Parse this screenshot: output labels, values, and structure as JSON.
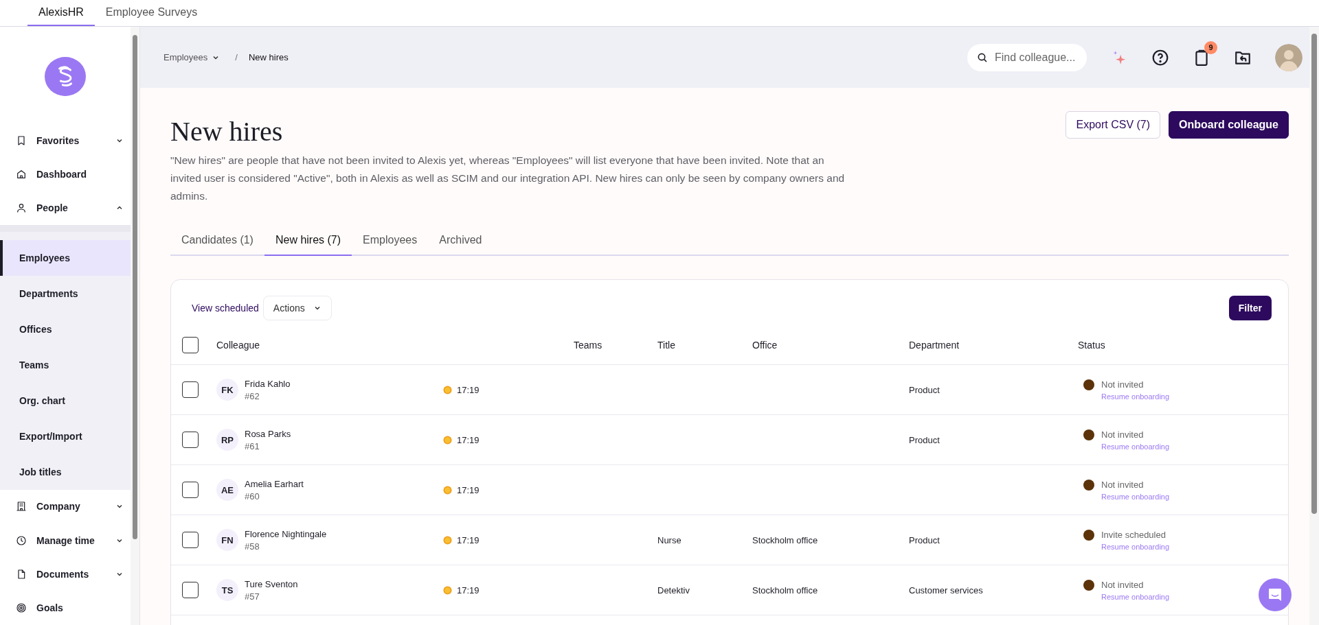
{
  "app_tabs": [
    {
      "label": "AlexisHR",
      "selected": true
    },
    {
      "label": "Employee Surveys",
      "selected": false
    }
  ],
  "sidebar": {
    "items": [
      {
        "label": "Favorites",
        "kind": "bookmark",
        "expanded": false
      },
      {
        "label": "Dashboard",
        "kind": "home"
      },
      {
        "label": "People",
        "kind": "person",
        "expanded": true,
        "children": [
          {
            "label": "Employees",
            "selected": true
          },
          {
            "label": "Departments",
            "selected": false
          },
          {
            "label": "Offices",
            "selected": false
          },
          {
            "label": "Teams",
            "selected": false
          },
          {
            "label": "Org. chart",
            "selected": false
          },
          {
            "label": "Export/Import",
            "selected": false
          },
          {
            "label": "Job titles",
            "selected": false
          }
        ]
      },
      {
        "label": "Company",
        "kind": "building",
        "expanded": false
      },
      {
        "label": "Manage time",
        "kind": "clock",
        "expanded": false
      },
      {
        "label": "Documents",
        "kind": "document",
        "expanded": false
      },
      {
        "label": "Goals",
        "kind": "target"
      }
    ]
  },
  "breadcrumb": [
    "Employees",
    "New hires"
  ],
  "breadcrumb_separator": "/",
  "search": {
    "placeholder": "Find colleague..."
  },
  "notifications_badge": "9",
  "page": {
    "title": "New hires",
    "description": "\"New hires\" are people that have not been invited to Alexis yet, whereas \"Employees\" will list everyone that have been invited. Note that an invited user is considered \"Active\", both in Alexis as well as SCIM and our integration API. New hires can only be seen by company owners and admins.",
    "buttons": [
      {
        "label": "Export CSV (7)",
        "kind": "secondary"
      },
      {
        "label": "Onboard colleague",
        "kind": "primary"
      }
    ]
  },
  "tabs": [
    {
      "label": "Candidates (1)",
      "selected": false
    },
    {
      "label": "New hires (7)",
      "selected": true
    },
    {
      "label": "Employees",
      "selected": false
    },
    {
      "label": "Archived",
      "selected": false
    }
  ],
  "toolbar": {
    "link": "View scheduled",
    "actions": "Actions",
    "filter": "Filter"
  },
  "table": {
    "select_all_checked": false,
    "columns": [
      "Colleague",
      "Teams",
      "Title",
      "Office",
      "Department",
      "Status"
    ],
    "rows": [
      {
        "checked": false,
        "initials": "FK",
        "name": "Frida Kahlo",
        "number": "#62",
        "time": "17:19",
        "department": "Product",
        "status": "Not invited",
        "action": "Resume onboarding"
      },
      {
        "checked": false,
        "initials": "RP",
        "name": "Rosa Parks",
        "number": "#61",
        "time": "17:19",
        "department": "Product",
        "status": "Not invited",
        "action": "Resume onboarding"
      },
      {
        "checked": false,
        "initials": "AE",
        "name": "Amelia Earhart",
        "number": "#60",
        "time": "17:19",
        "status": "Not invited",
        "action": "Resume onboarding"
      },
      {
        "checked": false,
        "initials": "FN",
        "name": "Florence Nightingale",
        "number": "#58",
        "time": "17:19",
        "title": "Nurse",
        "office": "Stockholm office",
        "department": "Product",
        "status": "Invite scheduled",
        "action": "Resume onboarding"
      },
      {
        "checked": false,
        "initials": "TS",
        "name": "Ture Sventon",
        "number": "#57",
        "time": "17:19",
        "title": "Detektiv",
        "office": "Stockholm office",
        "department": "Customer services",
        "status": "Not invited",
        "action": "Resume onboarding"
      }
    ]
  }
}
